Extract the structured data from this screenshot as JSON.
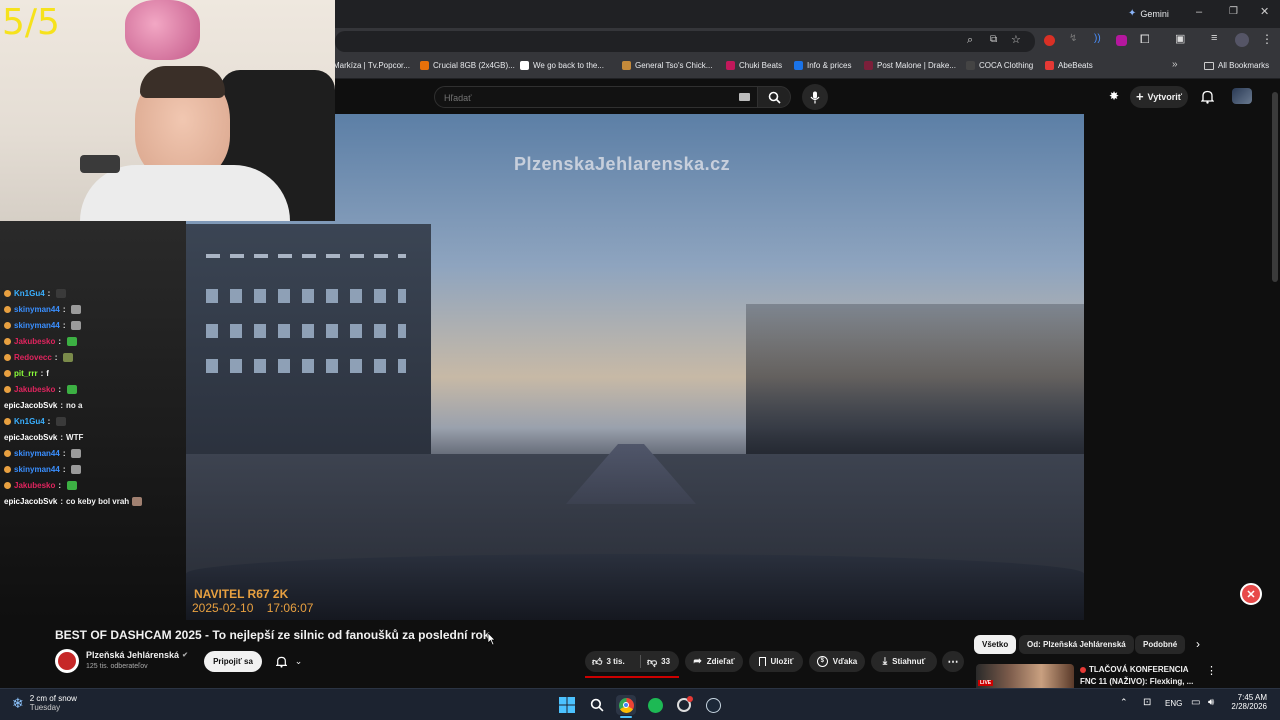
{
  "overlay": {
    "counter": "5/5"
  },
  "browser": {
    "gemini_label": "Gemini",
    "bookmarks": [
      {
        "label": "Markíza | Tv.Popcor...",
        "color": "#d9d9d9"
      },
      {
        "label": "Crucial 8GB (2x4GB)...",
        "color": "#e8710a"
      },
      {
        "label": "We go back to the...",
        "color": "#ffffff"
      },
      {
        "label": "General Tso's Chick...",
        "color": "#c58a3a"
      },
      {
        "label": "Chuki Beats",
        "color": "#c2185b"
      },
      {
        "label": "Info & prices",
        "color": "#1a73e8"
      },
      {
        "label": "Post Malone | Drake...",
        "color": "#7b1f3a"
      },
      {
        "label": "COCA Clothing",
        "color": "#444444"
      },
      {
        "label": "AbeBeats",
        "color": "#e53935"
      }
    ],
    "all_bookmarks": "All Bookmarks"
  },
  "youtube": {
    "search_placeholder": "Hľadať",
    "create_label": "Vytvoriť"
  },
  "video": {
    "watermark": "PlzenskaJehlarenska.cz",
    "cam_brand": "NAVITEL R67 2K",
    "cam_datetime": "2025-02-10    17:06:07",
    "title": "BEST OF DASHCAM 2025 - To nejlepší ze silnic od fanoušků za poslední rok"
  },
  "channel": {
    "name": "Plzeňská Jehlárenská",
    "subscribers": "125 tis. odberateľov",
    "join_label": "Pripojiť sa"
  },
  "actions": {
    "likes": "3 tis.",
    "dislikes": "33",
    "share": "Zdieľať",
    "save": "Uložiť",
    "thanks": "Vďaka",
    "download": "Stiahnuť"
  },
  "chips": [
    "Všetko",
    "Od: Plzeňská Jehlárenská",
    "Podobné"
  ],
  "recommendation": {
    "title_line1": "TLAČOVÁ KONFERENCIA",
    "title_line2": "FNC 11 (NAŽIVO): Flexking, ...",
    "live": "LIVE"
  },
  "chat": [
    {
      "user": "Kn1Gu4",
      "text": "",
      "color": "#3ab0ff",
      "emote": "#3a3a3a"
    },
    {
      "user": "skinyman44",
      "text": "",
      "color": "#3a8fff",
      "emote": "#9a9a9a"
    },
    {
      "user": "skinyman44",
      "text": "",
      "color": "#3a8fff",
      "emote": "#9a9a9a"
    },
    {
      "user": "Jakubesko",
      "text": "",
      "color": "#e0245e",
      "emote": "#3cb043"
    },
    {
      "user": "Redovecc",
      "text": "",
      "color": "#e0245e",
      "emote": "#7a8a4a"
    },
    {
      "user": "pit_rrr",
      "text": "f",
      "color": "#8bff3a",
      "emote": ""
    },
    {
      "user": "Jakubesko",
      "text": "",
      "color": "#e0245e",
      "emote": "#3cb043"
    },
    {
      "user": "epicJacobSvk",
      "text": "no a",
      "color": "#ffffff",
      "emote": ""
    },
    {
      "user": "Kn1Gu4",
      "text": "",
      "color": "#3ab0ff",
      "emote": "#3a3a3a"
    },
    {
      "user": "epicJacobSvk",
      "text": "WTF",
      "color": "#ffffff",
      "emote": ""
    },
    {
      "user": "skinyman44",
      "text": "",
      "color": "#3a8fff",
      "emote": "#9a9a9a"
    },
    {
      "user": "skinyman44",
      "text": "",
      "color": "#3a8fff",
      "emote": "#9a9a9a"
    },
    {
      "user": "Jakubesko",
      "text": "",
      "color": "#e0245e",
      "emote": "#3cb043"
    },
    {
      "user": "epicJacobSvk",
      "text": "co keby bol vrah",
      "color": "#ffffff",
      "emote": "#a08070"
    }
  ],
  "taskbar": {
    "weather_temp": "2 cm of snow",
    "weather_day": "Tuesday",
    "lang": "ENG",
    "time": "7:45 AM",
    "date": "2/28/2026"
  }
}
